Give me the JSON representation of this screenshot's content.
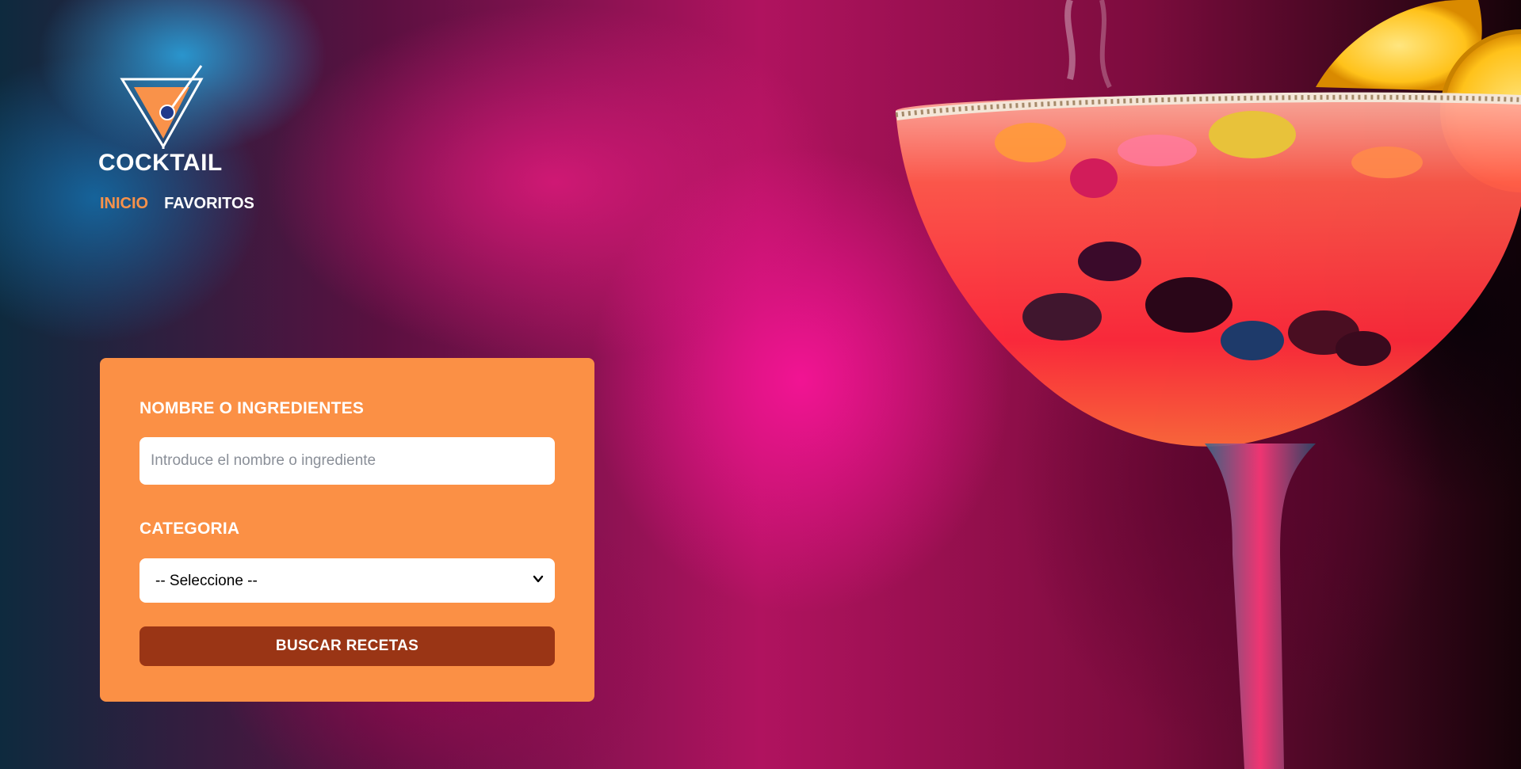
{
  "header": {
    "brand": "COCKTAIL",
    "logo_icon": "martini-glass-icon",
    "nav": [
      {
        "label": "INICIO",
        "active": true
      },
      {
        "label": "FAVORITOS",
        "active": false
      }
    ]
  },
  "search_form": {
    "name_label": "NOMBRE O INGREDIENTES",
    "name_placeholder": "Introduce el nombre o ingrediente",
    "name_value": "",
    "category_label": "CATEGORIA",
    "category_selected": "-- Seleccione --",
    "submit_label": "BUSCAR RECETAS"
  },
  "colors": {
    "accent_orange": "#fb9045",
    "active_nav": "#f9924a",
    "button_bg": "#9a3515",
    "text_light": "#ffffff"
  }
}
